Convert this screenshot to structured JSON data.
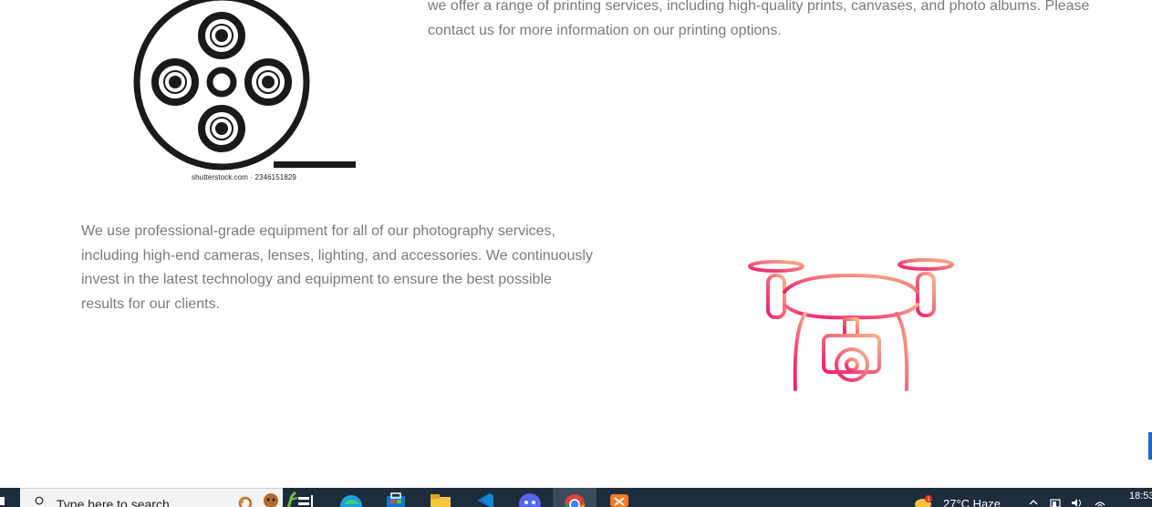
{
  "content": {
    "printing_text": "we offer a range of printing services, including high-quality prints, canvases, and photo albums. Please contact us for more information on our printing options.",
    "equipment_text": "We use professional-grade equipment for all of our photography services, including high-end cameras, lenses, lighting, and accessories. We continuously invest in the latest technology and equipment to ensure the best possible results for our clients.",
    "reel_image_watermark": "shutterstock.com · 2346151829",
    "film_reel_icon": "film-reel-icon",
    "drone_icon": "drone-camera-icon",
    "colors": {
      "body_text": "#7a7a7a",
      "drone_gradient_start": "#ee1c6f",
      "drone_gradient_end": "#f7b58a",
      "reel": "#1a1a1a"
    }
  },
  "taskbar": {
    "search_placeholder": "Type here to search",
    "weather_text": "27°C  Haze",
    "notification_count": "1",
    "clock_time": "18:53",
    "pinned_apps": [
      "task-view-icon",
      "edge-icon",
      "store-icon",
      "file-explorer-icon",
      "vscode-icon",
      "discord-icon",
      "chrome-icon",
      "xampp-icon"
    ],
    "colors": {
      "background": "#1e2d3b",
      "search_bg": "#f3f3f3"
    }
  }
}
